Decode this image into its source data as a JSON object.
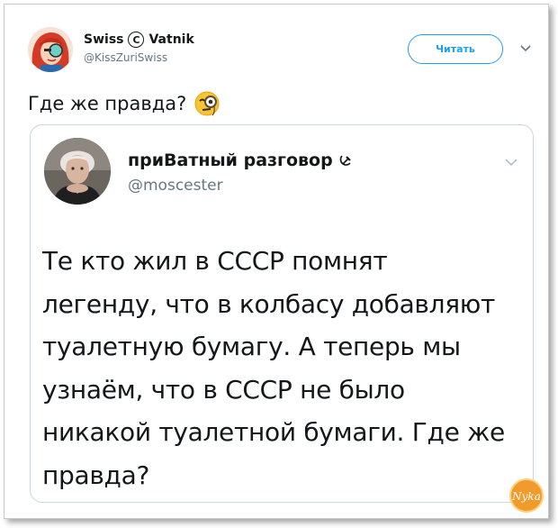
{
  "outer_tweet": {
    "display_name_left": "Swiss",
    "display_name_symbol": "C",
    "display_name_right": "Vatnik",
    "handle": "@KissZuriSwiss",
    "follow_label": "Читать",
    "text": "Где же правда?",
    "emoji": "face-with-monocle-icon"
  },
  "quoted_tweet": {
    "display_name": "приВатный разговор",
    "name_emoji": "hammer-and-sickle-icon",
    "handle": "@moscester",
    "lines": [
      "Те кто жил в СССР помнят",
      "легенду, что в колбасу добавляют",
      "туалетную бумагу. А теперь мы",
      "узнаём, что в СССР не было",
      "никакой туалетной бумаги. Где же",
      "правда?"
    ]
  },
  "watermark": {
    "text": "Nyka"
  },
  "colors": {
    "accent": "#1da1f2",
    "text": "#14171a",
    "muted": "#657786",
    "border": "#ccd6dd"
  }
}
